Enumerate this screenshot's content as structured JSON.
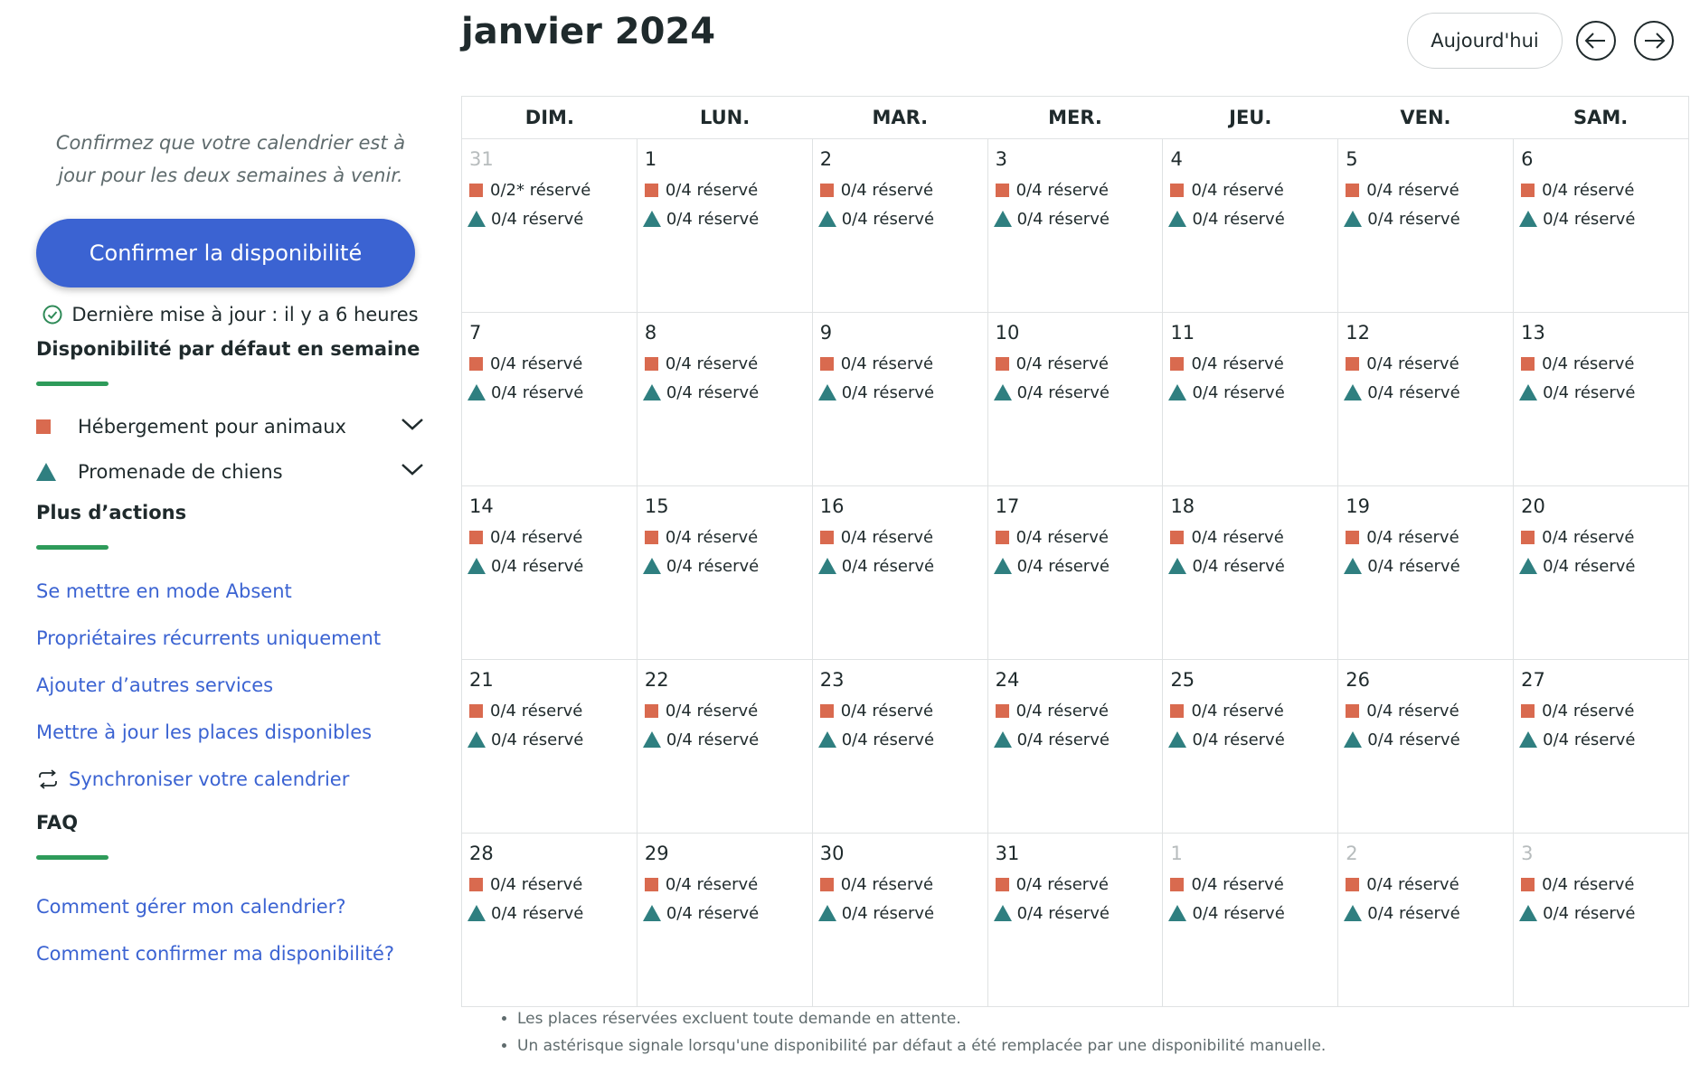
{
  "header": {
    "month_title": "janvier 2024",
    "today_label": "Aujourd'hui"
  },
  "sidebar": {
    "intro": "Confirmez que votre calendrier est à jour pour les deux semaines à venir.",
    "confirm_label": "Confirmer la disponibilité",
    "last_update": "Dernière mise à jour : il y a 6 heures",
    "default_availability_title": "Disponibilité par défaut en semaine",
    "services": [
      {
        "label": "Hébergement pour animaux",
        "icon": "square-icon",
        "color": "#d96a4f"
      },
      {
        "label": "Promenade de chiens",
        "icon": "triangle-icon",
        "color": "#2f7f80"
      }
    ],
    "more_actions_title": "Plus d’actions",
    "actions": [
      "Se mettre en mode Absent",
      "Propriétaires récurrents uniquement",
      "Ajouter d’autres services",
      "Mettre à jour les places disponibles",
      "Synchroniser votre calendrier"
    ],
    "faq_title": "FAQ",
    "faq_links": [
      "Comment gérer mon calendrier?",
      "Comment confirmer ma disponibilité?"
    ]
  },
  "calendar": {
    "weekdays": [
      "DIM.",
      "LUN.",
      "MAR.",
      "MER.",
      "JEU.",
      "VEN.",
      "SAM."
    ],
    "weeks": [
      [
        {
          "day": "31",
          "out": true,
          "r1": "0/2* réservé",
          "r2": "0/4 réservé"
        },
        {
          "day": "1",
          "out": false,
          "r1": "0/4 réservé",
          "r2": "0/4 réservé"
        },
        {
          "day": "2",
          "out": false,
          "r1": "0/4 réservé",
          "r2": "0/4 réservé"
        },
        {
          "day": "3",
          "out": false,
          "r1": "0/4 réservé",
          "r2": "0/4 réservé"
        },
        {
          "day": "4",
          "out": false,
          "r1": "0/4 réservé",
          "r2": "0/4 réservé"
        },
        {
          "day": "5",
          "out": false,
          "r1": "0/4 réservé",
          "r2": "0/4 réservé"
        },
        {
          "day": "6",
          "out": false,
          "r1": "0/4 réservé",
          "r2": "0/4 réservé"
        }
      ],
      [
        {
          "day": "7",
          "out": false,
          "r1": "0/4 réservé",
          "r2": "0/4 réservé"
        },
        {
          "day": "8",
          "out": false,
          "r1": "0/4 réservé",
          "r2": "0/4 réservé"
        },
        {
          "day": "9",
          "out": false,
          "r1": "0/4 réservé",
          "r2": "0/4 réservé"
        },
        {
          "day": "10",
          "out": false,
          "r1": "0/4 réservé",
          "r2": "0/4 réservé"
        },
        {
          "day": "11",
          "out": false,
          "r1": "0/4 réservé",
          "r2": "0/4 réservé"
        },
        {
          "day": "12",
          "out": false,
          "r1": "0/4 réservé",
          "r2": "0/4 réservé"
        },
        {
          "day": "13",
          "out": false,
          "r1": "0/4 réservé",
          "r2": "0/4 réservé"
        }
      ],
      [
        {
          "day": "14",
          "out": false,
          "r1": "0/4 réservé",
          "r2": "0/4 réservé"
        },
        {
          "day": "15",
          "out": false,
          "r1": "0/4 réservé",
          "r2": "0/4 réservé"
        },
        {
          "day": "16",
          "out": false,
          "r1": "0/4 réservé",
          "r2": "0/4 réservé"
        },
        {
          "day": "17",
          "out": false,
          "r1": "0/4 réservé",
          "r2": "0/4 réservé"
        },
        {
          "day": "18",
          "out": false,
          "r1": "0/4 réservé",
          "r2": "0/4 réservé"
        },
        {
          "day": "19",
          "out": false,
          "r1": "0/4 réservé",
          "r2": "0/4 réservé"
        },
        {
          "day": "20",
          "out": false,
          "r1": "0/4 réservé",
          "r2": "0/4 réservé"
        }
      ],
      [
        {
          "day": "21",
          "out": false,
          "r1": "0/4 réservé",
          "r2": "0/4 réservé"
        },
        {
          "day": "22",
          "out": false,
          "r1": "0/4 réservé",
          "r2": "0/4 réservé"
        },
        {
          "day": "23",
          "out": false,
          "r1": "0/4 réservé",
          "r2": "0/4 réservé"
        },
        {
          "day": "24",
          "out": false,
          "r1": "0/4 réservé",
          "r2": "0/4 réservé"
        },
        {
          "day": "25",
          "out": false,
          "r1": "0/4 réservé",
          "r2": "0/4 réservé"
        },
        {
          "day": "26",
          "out": false,
          "r1": "0/4 réservé",
          "r2": "0/4 réservé"
        },
        {
          "day": "27",
          "out": false,
          "r1": "0/4 réservé",
          "r2": "0/4 réservé"
        }
      ],
      [
        {
          "day": "28",
          "out": false,
          "r1": "0/4 réservé",
          "r2": "0/4 réservé"
        },
        {
          "day": "29",
          "out": false,
          "r1": "0/4 réservé",
          "r2": "0/4 réservé"
        },
        {
          "day": "30",
          "out": false,
          "r1": "0/4 réservé",
          "r2": "0/4 réservé"
        },
        {
          "day": "31",
          "out": false,
          "r1": "0/4 réservé",
          "r2": "0/4 réservé"
        },
        {
          "day": "1",
          "out": true,
          "r1": "0/4 réservé",
          "r2": "0/4 réservé"
        },
        {
          "day": "2",
          "out": true,
          "r1": "0/4 réservé",
          "r2": "0/4 réservé"
        },
        {
          "day": "3",
          "out": true,
          "r1": "0/4 réservé",
          "r2": "0/4 réservé"
        }
      ]
    ]
  },
  "notes": [
    "Les places réservées excluent toute demande en attente.",
    "Un astérisque signale lorsqu'une disponibilité par défaut a été remplacée par une disponibilité manuelle."
  ],
  "colors": {
    "accent": "#3b63d2",
    "boarding": "#d96a4f",
    "walking": "#2f7f80",
    "underline": "#2e9b5a"
  }
}
